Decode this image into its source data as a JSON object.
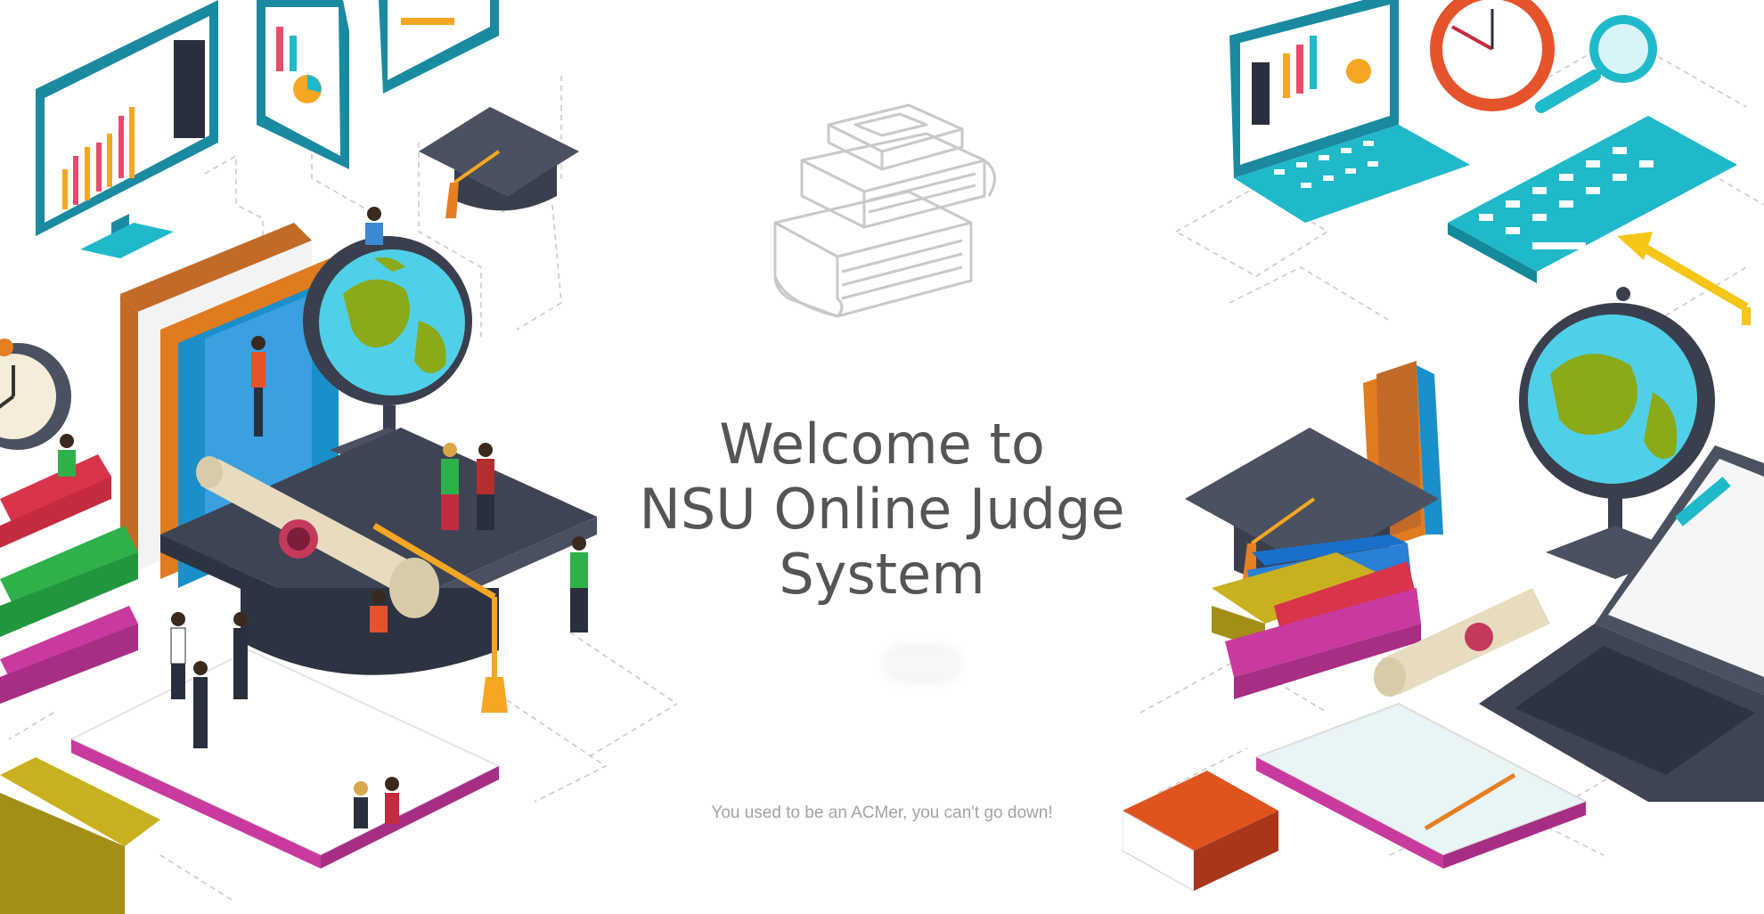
{
  "hero": {
    "title_line1": "Welcome to",
    "title_line2": "NSU Online Judge",
    "title_line3": "System",
    "motto": "You used to be an ACMer, you can't go down!"
  },
  "icons": {
    "center": "book-stack-icon",
    "left_illustration": "education-isometric-illustration",
    "right_illustration": "study-desk-isometric-illustration"
  },
  "colors": {
    "title": "#555555",
    "motto": "#a3a3a3",
    "teal": "#1fb9c9",
    "globe_sea": "#4fd0e8",
    "globe_land": "#8aaa1a",
    "cap": "#4a5160",
    "tassel": "#f5a623",
    "red_book": "#d8344a",
    "magenta_book": "#c93a9e",
    "orange_book": "#e0531f"
  }
}
